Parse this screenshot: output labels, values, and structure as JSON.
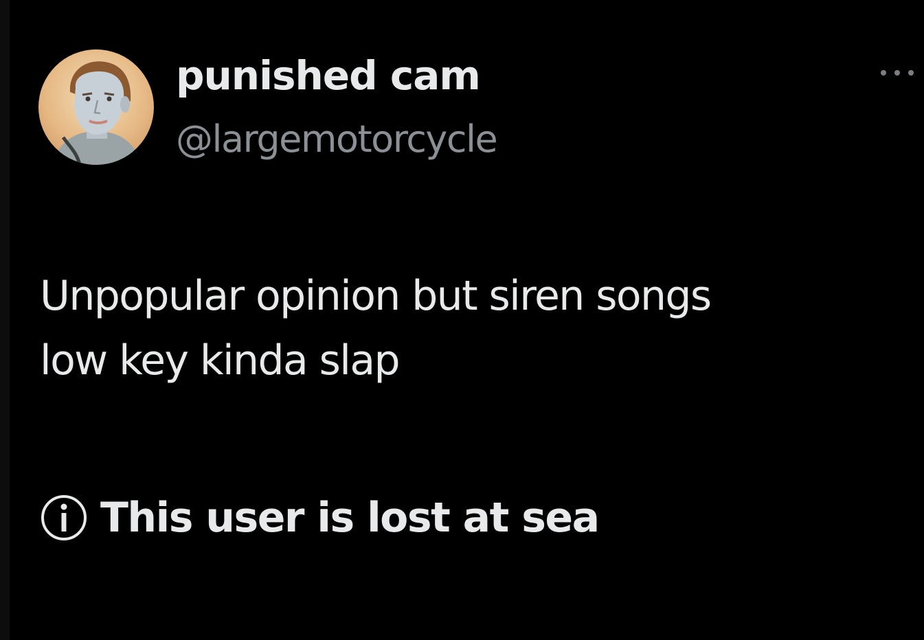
{
  "tweet": {
    "author": {
      "display_name": "punished cam",
      "handle": "@largemotorcycle",
      "avatar_icon": "avatar-portrait"
    },
    "more_icon": "more-options-icon",
    "text_lines": [
      "Unpopular opinion but siren songs",
      "low key kinda slap"
    ],
    "notice": {
      "icon": "info-icon",
      "text": "This user is lost at sea"
    }
  },
  "colors": {
    "background": "#000000",
    "primary_text": "#e7e9ea",
    "secondary_text": "#8b9096"
  }
}
